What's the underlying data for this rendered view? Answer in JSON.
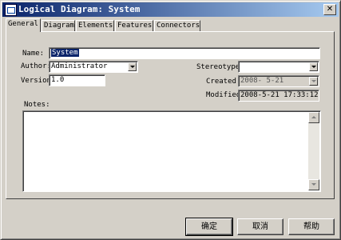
{
  "window": {
    "title": "Logical Diagram: System",
    "close_glyph": "✕"
  },
  "tabs": [
    {
      "label": "General"
    },
    {
      "label": "Diagram"
    },
    {
      "label": "Elements"
    },
    {
      "label": "Features"
    },
    {
      "label": "Connectors"
    }
  ],
  "form": {
    "name_label": "Name:",
    "name_value": "System",
    "author_label": "Author:",
    "author_value": "Administrator",
    "version_label": "Version:",
    "version_value": "1.0",
    "stereotype_label": "Stereotype",
    "stereotype_value": "",
    "created_label": "Created",
    "created_value": "2008- 5-21",
    "modified_label": "Modified:",
    "modified_value": "2008-5-21 17:33:12",
    "notes_label": "Notes:",
    "notes_value": ""
  },
  "buttons": {
    "ok": "确定",
    "cancel": "取消",
    "help": "帮助"
  },
  "icons": [
    "diagram-icon",
    "close-icon",
    "dropdown-arrow-icon",
    "scroll-up-icon",
    "scroll-down-icon"
  ]
}
